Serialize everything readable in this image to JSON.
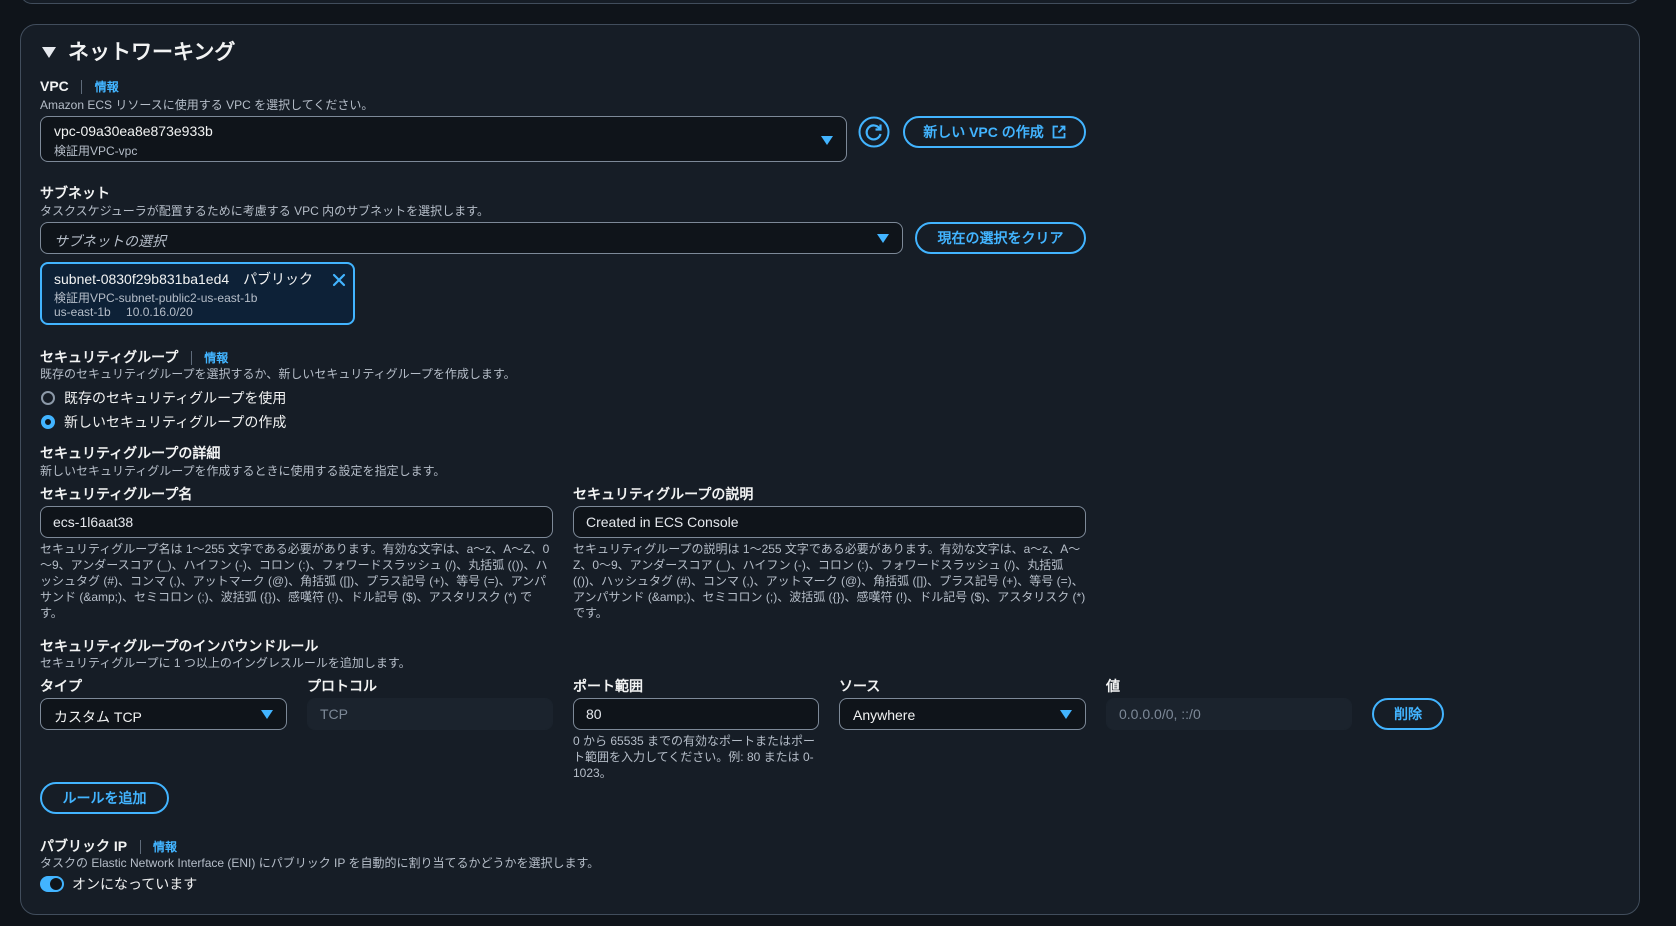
{
  "section": {
    "title": "ネットワーキング"
  },
  "vpc": {
    "label": "VPC",
    "info": "情報",
    "description": "Amazon ECS リソースに使用する VPC を選択してください。",
    "selected_id": "vpc-09a30ea8e873e933b",
    "selected_name": "検証用VPC-vpc",
    "create_button": "新しい VPC の作成"
  },
  "subnet": {
    "label": "サブネット",
    "description": "タスクスケジューラが配置するために考慮する VPC 内のサブネットを選択します。",
    "placeholder": "サブネットの選択",
    "clear_button": "現在の選択をクリア",
    "token": {
      "id": "subnet-0830f29b831ba1ed4",
      "type": "パブリック",
      "name": "検証用VPC-subnet-public2-us-east-1b",
      "az": "us-east-1b",
      "cidr": "10.0.16.0/20"
    }
  },
  "security_group": {
    "label": "セキュリティグループ",
    "info": "情報",
    "description": "既存のセキュリティグループを選択するか、新しいセキュリティグループを作成します。",
    "options": [
      "既存のセキュリティグループを使用",
      "新しいセキュリティグループの作成"
    ],
    "selected_index": 1
  },
  "sg_details": {
    "heading": "セキュリティグループの詳細",
    "description": "新しいセキュリティグループを作成するときに使用する設定を指定します。",
    "name_label": "セキュリティグループ名",
    "name_value": "ecs-1l6aat38",
    "name_help": "セキュリティグループ名は 1～255 文字である必要があります。有効な文字は、a～z、A～Z、0～9、アンダースコア (_)、ハイフン (-)、コロン (:)、フォワードスラッシュ (/)、丸括弧 (())、ハッシュタグ (#)、コンマ (,)、アットマーク (@)、角括弧 ([])、プラス記号 (+)、等号 (=)、アンパサンド (&amp;)、セミコロン (;)、波括弧 ({})、感嘆符 (!)、ドル記号 ($)、アスタリスク (*) です。",
    "desc_label": "セキュリティグループの説明",
    "desc_value": "Created in ECS Console",
    "desc_help": "セキュリティグループの説明は 1～255 文字である必要があります。有効な文字は、a～z、A～Z、0～9、アンダースコア (_)、ハイフン (-)、コロン (:)、フォワードスラッシュ (/)、丸括弧 (())、ハッシュタグ (#)、コンマ (,)、アットマーク (@)、角括弧 ([])、プラス記号 (+)、等号 (=)、アンパサンド (&amp;)、セミコロン (;)、波括弧 ({})、感嘆符 (!)、ドル記号 ($)、アスタリスク (*) です。"
  },
  "inbound": {
    "heading": "セキュリティグループのインバウンドルール",
    "description": "セキュリティグループに 1 つ以上のイングレスルールを追加します。",
    "col_type": "タイプ",
    "col_protocol": "プロトコル",
    "col_port": "ポート範囲",
    "col_source": "ソース",
    "col_value": "値",
    "type_value": "カスタム TCP",
    "protocol_value": "TCP",
    "port_value": "80",
    "port_help": "0 から 65535 までの有効なポートまたはポート範囲を入力してください。例: 80 または 0-1023。",
    "source_value": "Anywhere",
    "value_placeholder": "0.0.0.0/0, ::/0",
    "delete_button": "削除",
    "add_rule_button": "ルールを追加"
  },
  "public_ip": {
    "label": "パブリック IP",
    "info": "情報",
    "description": "タスクの Elastic Network Interface (ENI) にパブリック IP を自動的に割り当てるかどうかを選択します。",
    "toggle_label": "オンになっています",
    "enabled": true
  }
}
